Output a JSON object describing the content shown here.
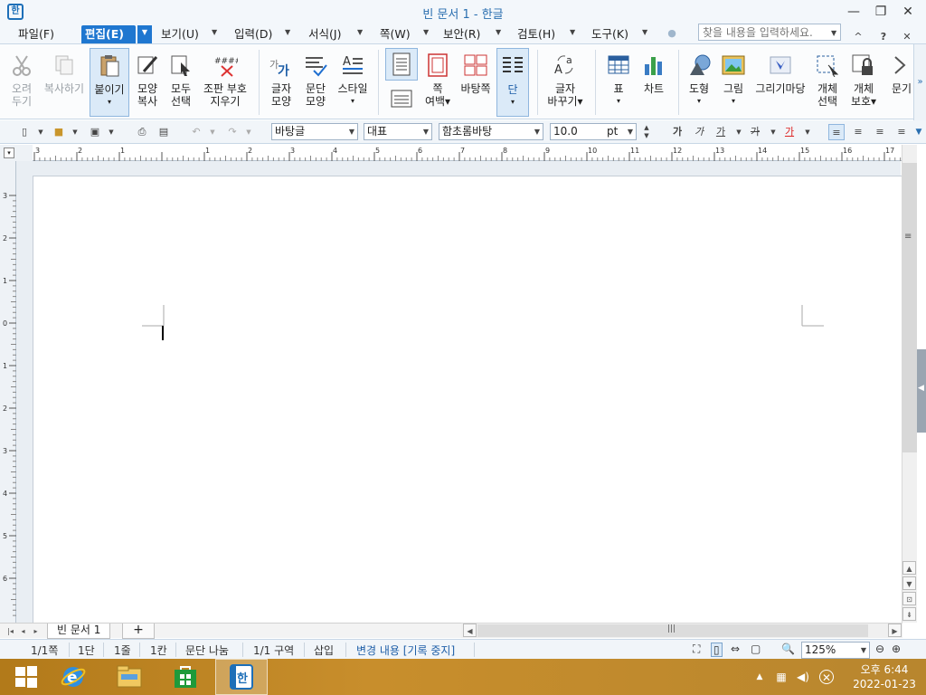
{
  "window": {
    "title": "빈 문서 1 - 한글",
    "app_icon_glyph": "한",
    "controls": {
      "minimize": "—",
      "restore": "❐",
      "close": "✕"
    }
  },
  "menu": {
    "items": [
      {
        "label": "파일(F)"
      },
      {
        "label": "편집(E)"
      },
      {
        "label": "보기(U)"
      },
      {
        "label": "입력(D)"
      },
      {
        "label": "서식(J)"
      },
      {
        "label": "쪽(W)"
      },
      {
        "label": "보안(R)"
      },
      {
        "label": "검토(H)"
      },
      {
        "label": "도구(K)"
      }
    ],
    "search_placeholder": "찾을 내용을 입력하세요.",
    "right_icons": {
      "caret_up": "^",
      "help": "?",
      "close": "✕"
    }
  },
  "ribbon": {
    "groups": [
      {
        "label1": "오려",
        "label2": "두기"
      },
      {
        "label1": "복사하기",
        "label2": ""
      },
      {
        "label1": "붙이기",
        "label2": "▾"
      },
      {
        "label1": "모양",
        "label2": "복사"
      },
      {
        "label1": "모두",
        "label2": "선택"
      },
      {
        "label1": "조판 부호",
        "label2": "지우기"
      },
      {
        "label1": "글자",
        "label2": "모양"
      },
      {
        "label1": "문단",
        "label2": "모양"
      },
      {
        "label1": "스타일",
        "label2": "▾"
      },
      {
        "label1": "쪽",
        "label2": "여백▾"
      },
      {
        "label1": "바탕쪽",
        "label2": ""
      },
      {
        "label1": "단",
        "label2": "▾"
      },
      {
        "label1": "글자",
        "label2": "바꾸기▾"
      },
      {
        "label1": "표",
        "label2": "▾"
      },
      {
        "label1": "차트",
        "label2": ""
      },
      {
        "label1": "도형",
        "label2": "▾"
      },
      {
        "label1": "그림",
        "label2": "▾"
      },
      {
        "label1": "그리기마당",
        "label2": ""
      },
      {
        "label1": "개체",
        "label2": "선택"
      },
      {
        "label1": "개체",
        "label2": "보호▾"
      },
      {
        "label1": "문기",
        "label2": ""
      }
    ]
  },
  "format_toolbar": {
    "style": "바탕글",
    "language": "대표",
    "font": "함초롬바탕",
    "size": "10.0",
    "size_unit": "pt",
    "char_buttons": [
      "가",
      "가",
      "가",
      "가",
      "가"
    ]
  },
  "ruler": {
    "h_ticks": [
      "3",
      "2",
      "1",
      "",
      "1",
      "2",
      "3",
      "4",
      "5",
      "6",
      "7",
      "8",
      "9",
      "10",
      "11",
      "12",
      "13",
      "14",
      "15",
      "16",
      "17"
    ],
    "v_ticks": [
      "3",
      "2",
      "1",
      "0",
      "1",
      "2",
      "3",
      "4",
      "5",
      "6"
    ]
  },
  "tabs": {
    "doc_tab": "빈 문서 1",
    "add": "+"
  },
  "status": {
    "page": "1/1쪽",
    "column": "1단",
    "line": "1줄",
    "col": "1칸",
    "para_break": "문단 나눔",
    "section": "1/1 구역",
    "mode": "삽입",
    "track": "변경 내용 [기록 중지]",
    "zoom": "125%"
  },
  "taskbar": {
    "clock_time": "오후 6:44",
    "clock_date": "2022-01-23"
  }
}
